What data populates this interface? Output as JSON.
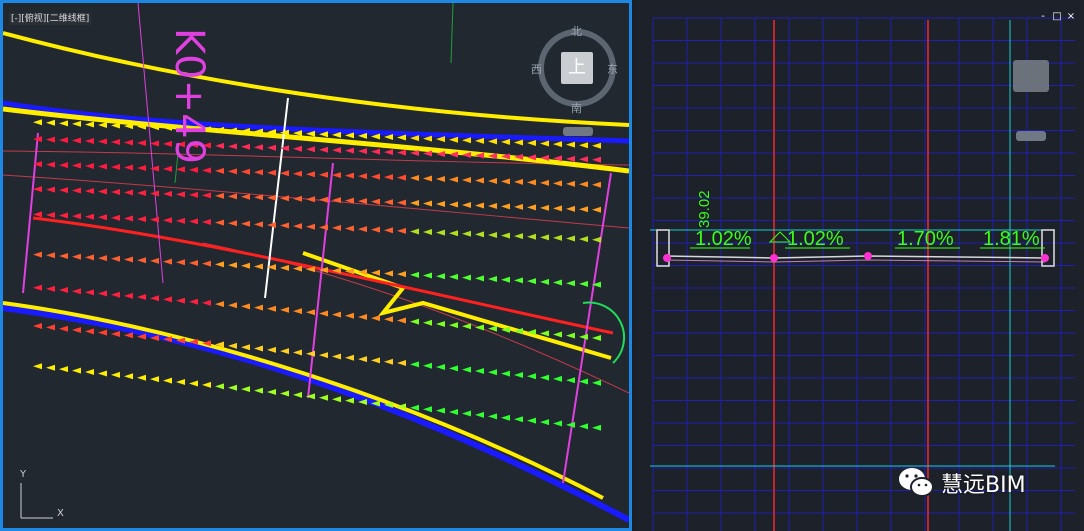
{
  "left_viewport": {
    "title": "[-][俯视][二维线框]",
    "station_label": "K0+49",
    "compass": {
      "north": "北",
      "south": "南",
      "east": "东",
      "west": "西",
      "center": "上"
    },
    "ucs_y": "Y",
    "ucs_x": "X"
  },
  "right_viewport": {
    "slopes": [
      "1.02%",
      "1.02%",
      "1.70%",
      "1.81%"
    ],
    "elevation_label": "39.02",
    "window_controls": [
      "-",
      "□",
      "×"
    ]
  },
  "watermark": {
    "text": "慧远BIM",
    "icon": "wechat-icon"
  },
  "colors": {
    "viewport_border": "#1e88e5",
    "road_edge": "#ffee00",
    "alignment": "#ff2020",
    "boundary_blue": "#1a1aff",
    "section_grid": "#1f1fb0",
    "slope_text": "#39ff14",
    "magenta": "#e040e0"
  }
}
